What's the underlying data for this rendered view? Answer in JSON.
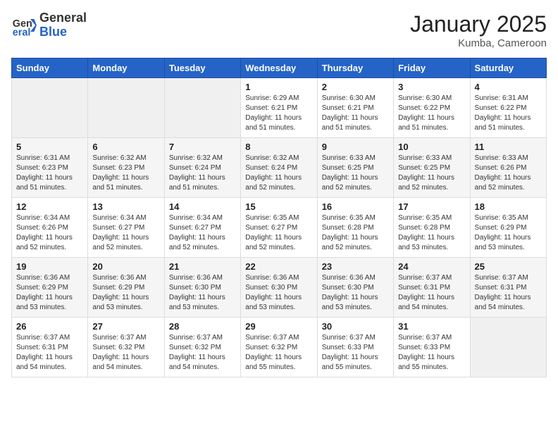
{
  "header": {
    "logo_general": "General",
    "logo_blue": "Blue",
    "month_title": "January 2025",
    "location": "Kumba, Cameroon"
  },
  "weekdays": [
    "Sunday",
    "Monday",
    "Tuesday",
    "Wednesday",
    "Thursday",
    "Friday",
    "Saturday"
  ],
  "weeks": [
    [
      {
        "day": "",
        "info": ""
      },
      {
        "day": "",
        "info": ""
      },
      {
        "day": "",
        "info": ""
      },
      {
        "day": "1",
        "info": "Sunrise: 6:29 AM\nSunset: 6:21 PM\nDaylight: 11 hours\nand 51 minutes."
      },
      {
        "day": "2",
        "info": "Sunrise: 6:30 AM\nSunset: 6:21 PM\nDaylight: 11 hours\nand 51 minutes."
      },
      {
        "day": "3",
        "info": "Sunrise: 6:30 AM\nSunset: 6:22 PM\nDaylight: 11 hours\nand 51 minutes."
      },
      {
        "day": "4",
        "info": "Sunrise: 6:31 AM\nSunset: 6:22 PM\nDaylight: 11 hours\nand 51 minutes."
      }
    ],
    [
      {
        "day": "5",
        "info": "Sunrise: 6:31 AM\nSunset: 6:23 PM\nDaylight: 11 hours\nand 51 minutes."
      },
      {
        "day": "6",
        "info": "Sunrise: 6:32 AM\nSunset: 6:23 PM\nDaylight: 11 hours\nand 51 minutes."
      },
      {
        "day": "7",
        "info": "Sunrise: 6:32 AM\nSunset: 6:24 PM\nDaylight: 11 hours\nand 51 minutes."
      },
      {
        "day": "8",
        "info": "Sunrise: 6:32 AM\nSunset: 6:24 PM\nDaylight: 11 hours\nand 52 minutes."
      },
      {
        "day": "9",
        "info": "Sunrise: 6:33 AM\nSunset: 6:25 PM\nDaylight: 11 hours\nand 52 minutes."
      },
      {
        "day": "10",
        "info": "Sunrise: 6:33 AM\nSunset: 6:25 PM\nDaylight: 11 hours\nand 52 minutes."
      },
      {
        "day": "11",
        "info": "Sunrise: 6:33 AM\nSunset: 6:26 PM\nDaylight: 11 hours\nand 52 minutes."
      }
    ],
    [
      {
        "day": "12",
        "info": "Sunrise: 6:34 AM\nSunset: 6:26 PM\nDaylight: 11 hours\nand 52 minutes."
      },
      {
        "day": "13",
        "info": "Sunrise: 6:34 AM\nSunset: 6:27 PM\nDaylight: 11 hours\nand 52 minutes."
      },
      {
        "day": "14",
        "info": "Sunrise: 6:34 AM\nSunset: 6:27 PM\nDaylight: 11 hours\nand 52 minutes."
      },
      {
        "day": "15",
        "info": "Sunrise: 6:35 AM\nSunset: 6:27 PM\nDaylight: 11 hours\nand 52 minutes."
      },
      {
        "day": "16",
        "info": "Sunrise: 6:35 AM\nSunset: 6:28 PM\nDaylight: 11 hours\nand 52 minutes."
      },
      {
        "day": "17",
        "info": "Sunrise: 6:35 AM\nSunset: 6:28 PM\nDaylight: 11 hours\nand 53 minutes."
      },
      {
        "day": "18",
        "info": "Sunrise: 6:35 AM\nSunset: 6:29 PM\nDaylight: 11 hours\nand 53 minutes."
      }
    ],
    [
      {
        "day": "19",
        "info": "Sunrise: 6:36 AM\nSunset: 6:29 PM\nDaylight: 11 hours\nand 53 minutes."
      },
      {
        "day": "20",
        "info": "Sunrise: 6:36 AM\nSunset: 6:29 PM\nDaylight: 11 hours\nand 53 minutes."
      },
      {
        "day": "21",
        "info": "Sunrise: 6:36 AM\nSunset: 6:30 PM\nDaylight: 11 hours\nand 53 minutes."
      },
      {
        "day": "22",
        "info": "Sunrise: 6:36 AM\nSunset: 6:30 PM\nDaylight: 11 hours\nand 53 minutes."
      },
      {
        "day": "23",
        "info": "Sunrise: 6:36 AM\nSunset: 6:30 PM\nDaylight: 11 hours\nand 53 minutes."
      },
      {
        "day": "24",
        "info": "Sunrise: 6:37 AM\nSunset: 6:31 PM\nDaylight: 11 hours\nand 54 minutes."
      },
      {
        "day": "25",
        "info": "Sunrise: 6:37 AM\nSunset: 6:31 PM\nDaylight: 11 hours\nand 54 minutes."
      }
    ],
    [
      {
        "day": "26",
        "info": "Sunrise: 6:37 AM\nSunset: 6:31 PM\nDaylight: 11 hours\nand 54 minutes."
      },
      {
        "day": "27",
        "info": "Sunrise: 6:37 AM\nSunset: 6:32 PM\nDaylight: 11 hours\nand 54 minutes."
      },
      {
        "day": "28",
        "info": "Sunrise: 6:37 AM\nSunset: 6:32 PM\nDaylight: 11 hours\nand 54 minutes."
      },
      {
        "day": "29",
        "info": "Sunrise: 6:37 AM\nSunset: 6:32 PM\nDaylight: 11 hours\nand 55 minutes."
      },
      {
        "day": "30",
        "info": "Sunrise: 6:37 AM\nSunset: 6:33 PM\nDaylight: 11 hours\nand 55 minutes."
      },
      {
        "day": "31",
        "info": "Sunrise: 6:37 AM\nSunset: 6:33 PM\nDaylight: 11 hours\nand 55 minutes."
      },
      {
        "day": "",
        "info": ""
      }
    ]
  ]
}
